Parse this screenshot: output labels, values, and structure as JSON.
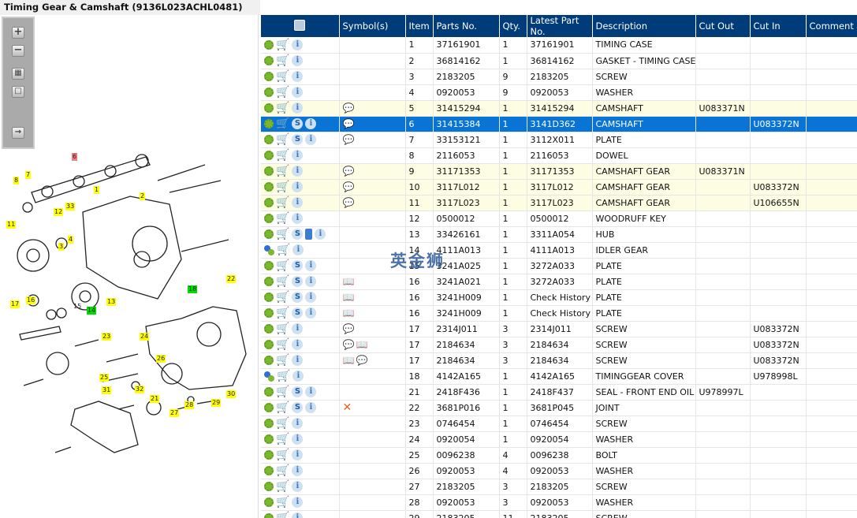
{
  "title": "Timing Gear & Camshaft (9136L023ACHL0481)",
  "toolbar": {
    "zoom_in": "+",
    "zoom_out": "−",
    "fit": "▦",
    "actual": "□",
    "export": "→"
  },
  "watermark": "英金狮",
  "diagram_labels": [
    "8",
    "7",
    "6",
    "1",
    "2",
    "12",
    "33",
    "11",
    "4",
    "3",
    "13",
    "14",
    "15",
    "16",
    "17",
    "18",
    "22",
    "23",
    "24",
    "26",
    "25",
    "31",
    "32",
    "21",
    "28",
    "27",
    "29",
    "30"
  ],
  "columns": [
    "",
    "Symbol(s)",
    "Item",
    "Parts No.",
    "Qty.",
    "Latest Part No.",
    "Description",
    "Cut Out",
    "Cut In",
    "Comment"
  ],
  "colors": {
    "header": "#003c7a",
    "selected": "#0a74d6",
    "highlight": "#fdfde4"
  },
  "rows": [
    {
      "gear": "green",
      "s": false,
      "book": false,
      "symbols": [],
      "item": "1",
      "part": "37161901",
      "qty": "1",
      "latest": "37161901",
      "desc": "TIMING CASE",
      "cutout": "",
      "cutin": "",
      "comment": ""
    },
    {
      "gear": "green",
      "s": false,
      "book": false,
      "symbols": [],
      "item": "2",
      "part": "36814162",
      "qty": "1",
      "latest": "36814162",
      "desc": "GASKET - TIMING CASE",
      "cutout": "",
      "cutin": "",
      "comment": ""
    },
    {
      "gear": "green",
      "s": false,
      "book": false,
      "symbols": [],
      "item": "3",
      "part": "2183205",
      "qty": "9",
      "latest": "2183205",
      "desc": "SCREW",
      "cutout": "",
      "cutin": "",
      "comment": ""
    },
    {
      "gear": "green",
      "s": false,
      "book": false,
      "symbols": [],
      "item": "4",
      "part": "0920053",
      "qty": "9",
      "latest": "0920053",
      "desc": "WASHER",
      "cutout": "",
      "cutin": "",
      "comment": ""
    },
    {
      "gear": "green",
      "s": false,
      "book": false,
      "symbols": [
        "note"
      ],
      "state": "hl",
      "item": "5",
      "part": "31415294",
      "qty": "1",
      "latest": "31415294",
      "desc": "CAMSHAFT",
      "cutout": "U083371N",
      "cutin": "",
      "comment": ""
    },
    {
      "gear": "green",
      "s": true,
      "book": false,
      "symbols": [
        "note"
      ],
      "state": "sel",
      "item": "6",
      "part": "31415384",
      "qty": "1",
      "latest": "3141D362",
      "desc": "CAMSHAFT",
      "cutout": "",
      "cutin": "U083372N",
      "comment": ""
    },
    {
      "gear": "green",
      "s": true,
      "book": false,
      "symbols": [
        "note"
      ],
      "item": "7",
      "part": "33153121",
      "qty": "1",
      "latest": "3112X011",
      "desc": "PLATE",
      "cutout": "",
      "cutin": "",
      "comment": ""
    },
    {
      "gear": "green",
      "s": false,
      "book": false,
      "symbols": [],
      "item": "8",
      "part": "2116053",
      "qty": "1",
      "latest": "2116053",
      "desc": "DOWEL",
      "cutout": "",
      "cutin": "",
      "comment": ""
    },
    {
      "gear": "green",
      "s": false,
      "book": false,
      "symbols": [
        "note"
      ],
      "state": "hl",
      "item": "9",
      "part": "31171353",
      "qty": "1",
      "latest": "31171353",
      "desc": "CAMSHAFT GEAR",
      "cutout": "U083371N",
      "cutin": "",
      "comment": ""
    },
    {
      "gear": "green",
      "s": false,
      "book": false,
      "symbols": [
        "note"
      ],
      "state": "hl",
      "item": "10",
      "part": "3117L012",
      "qty": "1",
      "latest": "3117L012",
      "desc": "CAMSHAFT GEAR",
      "cutout": "",
      "cutin": "U083372N",
      "comment": ""
    },
    {
      "gear": "green",
      "s": false,
      "book": false,
      "symbols": [
        "note"
      ],
      "state": "hl",
      "item": "11",
      "part": "3117L023",
      "qty": "1",
      "latest": "3117L023",
      "desc": "CAMSHAFT GEAR",
      "cutout": "",
      "cutin": "U106655N",
      "comment": ""
    },
    {
      "gear": "green",
      "s": false,
      "book": false,
      "symbols": [],
      "item": "12",
      "part": "0500012",
      "qty": "1",
      "latest": "0500012",
      "desc": "WOODRUFF KEY",
      "cutout": "",
      "cutin": "",
      "comment": ""
    },
    {
      "gear": "green",
      "s": true,
      "book": true,
      "symbols": [],
      "item": "13",
      "part": "33426161",
      "qty": "1",
      "latest": "3311A054",
      "desc": "HUB",
      "cutout": "",
      "cutin": "",
      "comment": ""
    },
    {
      "gear": "blue",
      "s": false,
      "book": false,
      "symbols": [],
      "item": "14",
      "part": "4111A013",
      "qty": "1",
      "latest": "4111A013",
      "desc": "IDLER GEAR",
      "cutout": "",
      "cutin": "",
      "comment": ""
    },
    {
      "gear": "green",
      "s": true,
      "book": false,
      "symbols": [],
      "item": "15",
      "part": "3241A025",
      "qty": "1",
      "latest": "3272A033",
      "desc": "PLATE",
      "cutout": "",
      "cutin": "",
      "comment": ""
    },
    {
      "gear": "green",
      "s": true,
      "book": false,
      "symbols": [
        "history"
      ],
      "item": "16",
      "part": "3241A021",
      "qty": "1",
      "latest": "3272A033",
      "desc": "PLATE",
      "cutout": "",
      "cutin": "",
      "comment": ""
    },
    {
      "gear": "green",
      "s": true,
      "book": false,
      "symbols": [
        "history"
      ],
      "item": "16",
      "part": "3241H009",
      "qty": "1",
      "latest": "Check History",
      "desc": "PLATE",
      "cutout": "",
      "cutin": "",
      "comment": ""
    },
    {
      "gear": "green",
      "s": true,
      "book": false,
      "symbols": [
        "history"
      ],
      "item": "16",
      "part": "3241H009",
      "qty": "1",
      "latest": "Check History",
      "desc": "PLATE",
      "cutout": "",
      "cutin": "",
      "comment": ""
    },
    {
      "gear": "green",
      "s": false,
      "book": false,
      "symbols": [
        "note"
      ],
      "item": "17",
      "part": "2314J011",
      "qty": "3",
      "latest": "2314J011",
      "desc": "SCREW",
      "cutout": "",
      "cutin": "U083372N",
      "comment": ""
    },
    {
      "gear": "green",
      "s": false,
      "book": false,
      "symbols": [
        "note",
        "history"
      ],
      "item": "17",
      "part": "2184634",
      "qty": "3",
      "latest": "2184634",
      "desc": "SCREW",
      "cutout": "",
      "cutin": "U083372N",
      "comment": ""
    },
    {
      "gear": "green",
      "s": false,
      "book": false,
      "symbols": [
        "history",
        "note"
      ],
      "item": "17",
      "part": "2184634",
      "qty": "3",
      "latest": "2184634",
      "desc": "SCREW",
      "cutout": "",
      "cutin": "U083372N",
      "comment": ""
    },
    {
      "gear": "blue",
      "s": false,
      "book": false,
      "symbols": [],
      "item": "18",
      "part": "4142A165",
      "qty": "1",
      "latest": "4142A165",
      "desc": "TIMINGGEAR COVER",
      "cutout": "",
      "cutin": "U978998L",
      "comment": ""
    },
    {
      "gear": "green",
      "s": true,
      "book": false,
      "symbols": [],
      "item": "21",
      "part": "2418F436",
      "qty": "1",
      "latest": "2418F437",
      "desc": "SEAL - FRONT END OIL",
      "cutout": "U978997L",
      "cutin": "",
      "comment": ""
    },
    {
      "gear": "green",
      "s": true,
      "book": false,
      "symbols": [
        "cross"
      ],
      "item": "22",
      "part": "3681P016",
      "qty": "1",
      "latest": "3681P045",
      "desc": "JOINT",
      "cutout": "",
      "cutin": "",
      "comment": ""
    },
    {
      "gear": "green",
      "s": false,
      "book": false,
      "symbols": [],
      "item": "23",
      "part": "0746454",
      "qty": "1",
      "latest": "0746454",
      "desc": "SCREW",
      "cutout": "",
      "cutin": "",
      "comment": ""
    },
    {
      "gear": "green",
      "s": false,
      "book": false,
      "symbols": [],
      "item": "24",
      "part": "0920054",
      "qty": "1",
      "latest": "0920054",
      "desc": "WASHER",
      "cutout": "",
      "cutin": "",
      "comment": ""
    },
    {
      "gear": "green",
      "s": false,
      "book": false,
      "symbols": [],
      "item": "25",
      "part": "0096238",
      "qty": "4",
      "latest": "0096238",
      "desc": "BOLT",
      "cutout": "",
      "cutin": "",
      "comment": ""
    },
    {
      "gear": "green",
      "s": false,
      "book": false,
      "symbols": [],
      "item": "26",
      "part": "0920053",
      "qty": "4",
      "latest": "0920053",
      "desc": "WASHER",
      "cutout": "",
      "cutin": "",
      "comment": ""
    },
    {
      "gear": "green",
      "s": false,
      "book": false,
      "symbols": [],
      "item": "27",
      "part": "2183205",
      "qty": "3",
      "latest": "2183205",
      "desc": "SCREW",
      "cutout": "",
      "cutin": "",
      "comment": ""
    },
    {
      "gear": "green",
      "s": false,
      "book": false,
      "symbols": [],
      "item": "28",
      "part": "0920053",
      "qty": "3",
      "latest": "0920053",
      "desc": "WASHER",
      "cutout": "",
      "cutin": "",
      "comment": ""
    },
    {
      "gear": "green",
      "s": false,
      "book": false,
      "symbols": [],
      "item": "29",
      "part": "2183205",
      "qty": "11",
      "latest": "2183205",
      "desc": "SCREW",
      "cutout": "",
      "cutin": "",
      "comment": ""
    }
  ]
}
